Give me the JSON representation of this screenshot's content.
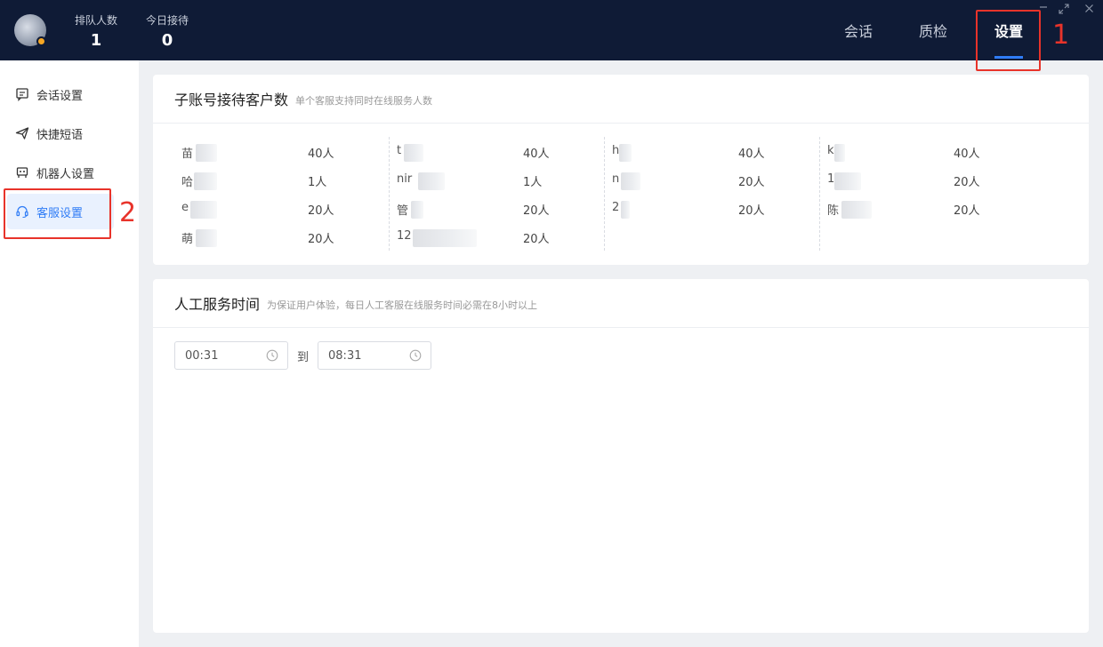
{
  "header": {
    "queue_label": "排队人数",
    "queue_value": "1",
    "today_label": "今日接待",
    "today_value": "0",
    "tabs": [
      {
        "label": "会话",
        "active": false
      },
      {
        "label": "质检",
        "active": false
      },
      {
        "label": "设置",
        "active": true
      }
    ],
    "accent_color": "#2f7cf6",
    "status_dot_color": "#f5a623"
  },
  "sidebar": {
    "items": [
      {
        "label": "会话设置",
        "icon": "chat-settings-icon",
        "active": false
      },
      {
        "label": "快捷短语",
        "icon": "send-plane-icon",
        "active": false
      },
      {
        "label": "机器人设置",
        "icon": "robot-icon",
        "active": false
      },
      {
        "label": "客服设置",
        "icon": "headset-icon",
        "active": true
      }
    ]
  },
  "annotations": [
    "1",
    "2"
  ],
  "accounts_card": {
    "title": "子账号接待客户数",
    "subtitle": "单个客服支持同时在线服务人数",
    "columns": [
      [
        {
          "name": "苗",
          "count": "40人"
        },
        {
          "name": "哈",
          "count": "1人"
        },
        {
          "name": "e",
          "count": "20人"
        },
        {
          "name": "萌",
          "count": "20人"
        }
      ],
      [
        {
          "name": "t",
          "count": "40人"
        },
        {
          "name": "nir",
          "count": "1人"
        },
        {
          "name": "管",
          "count": "20人"
        },
        {
          "name": "12",
          "count": "20人"
        }
      ],
      [
        {
          "name": "h",
          "count": "40人"
        },
        {
          "name": "n",
          "count": "20人"
        },
        {
          "name": "2",
          "count": "20人"
        }
      ],
      [
        {
          "name": "k",
          "count": "40人"
        },
        {
          "name": "1",
          "count": "20人"
        },
        {
          "name": "陈",
          "count": "20人"
        }
      ]
    ]
  },
  "service_time_card": {
    "title": "人工服务时间",
    "subtitle": "为保证用户体验，每日人工客服在线服务时间必需在8小时以上",
    "start_time": "00:31",
    "separator": "到",
    "end_time": "08:31"
  }
}
